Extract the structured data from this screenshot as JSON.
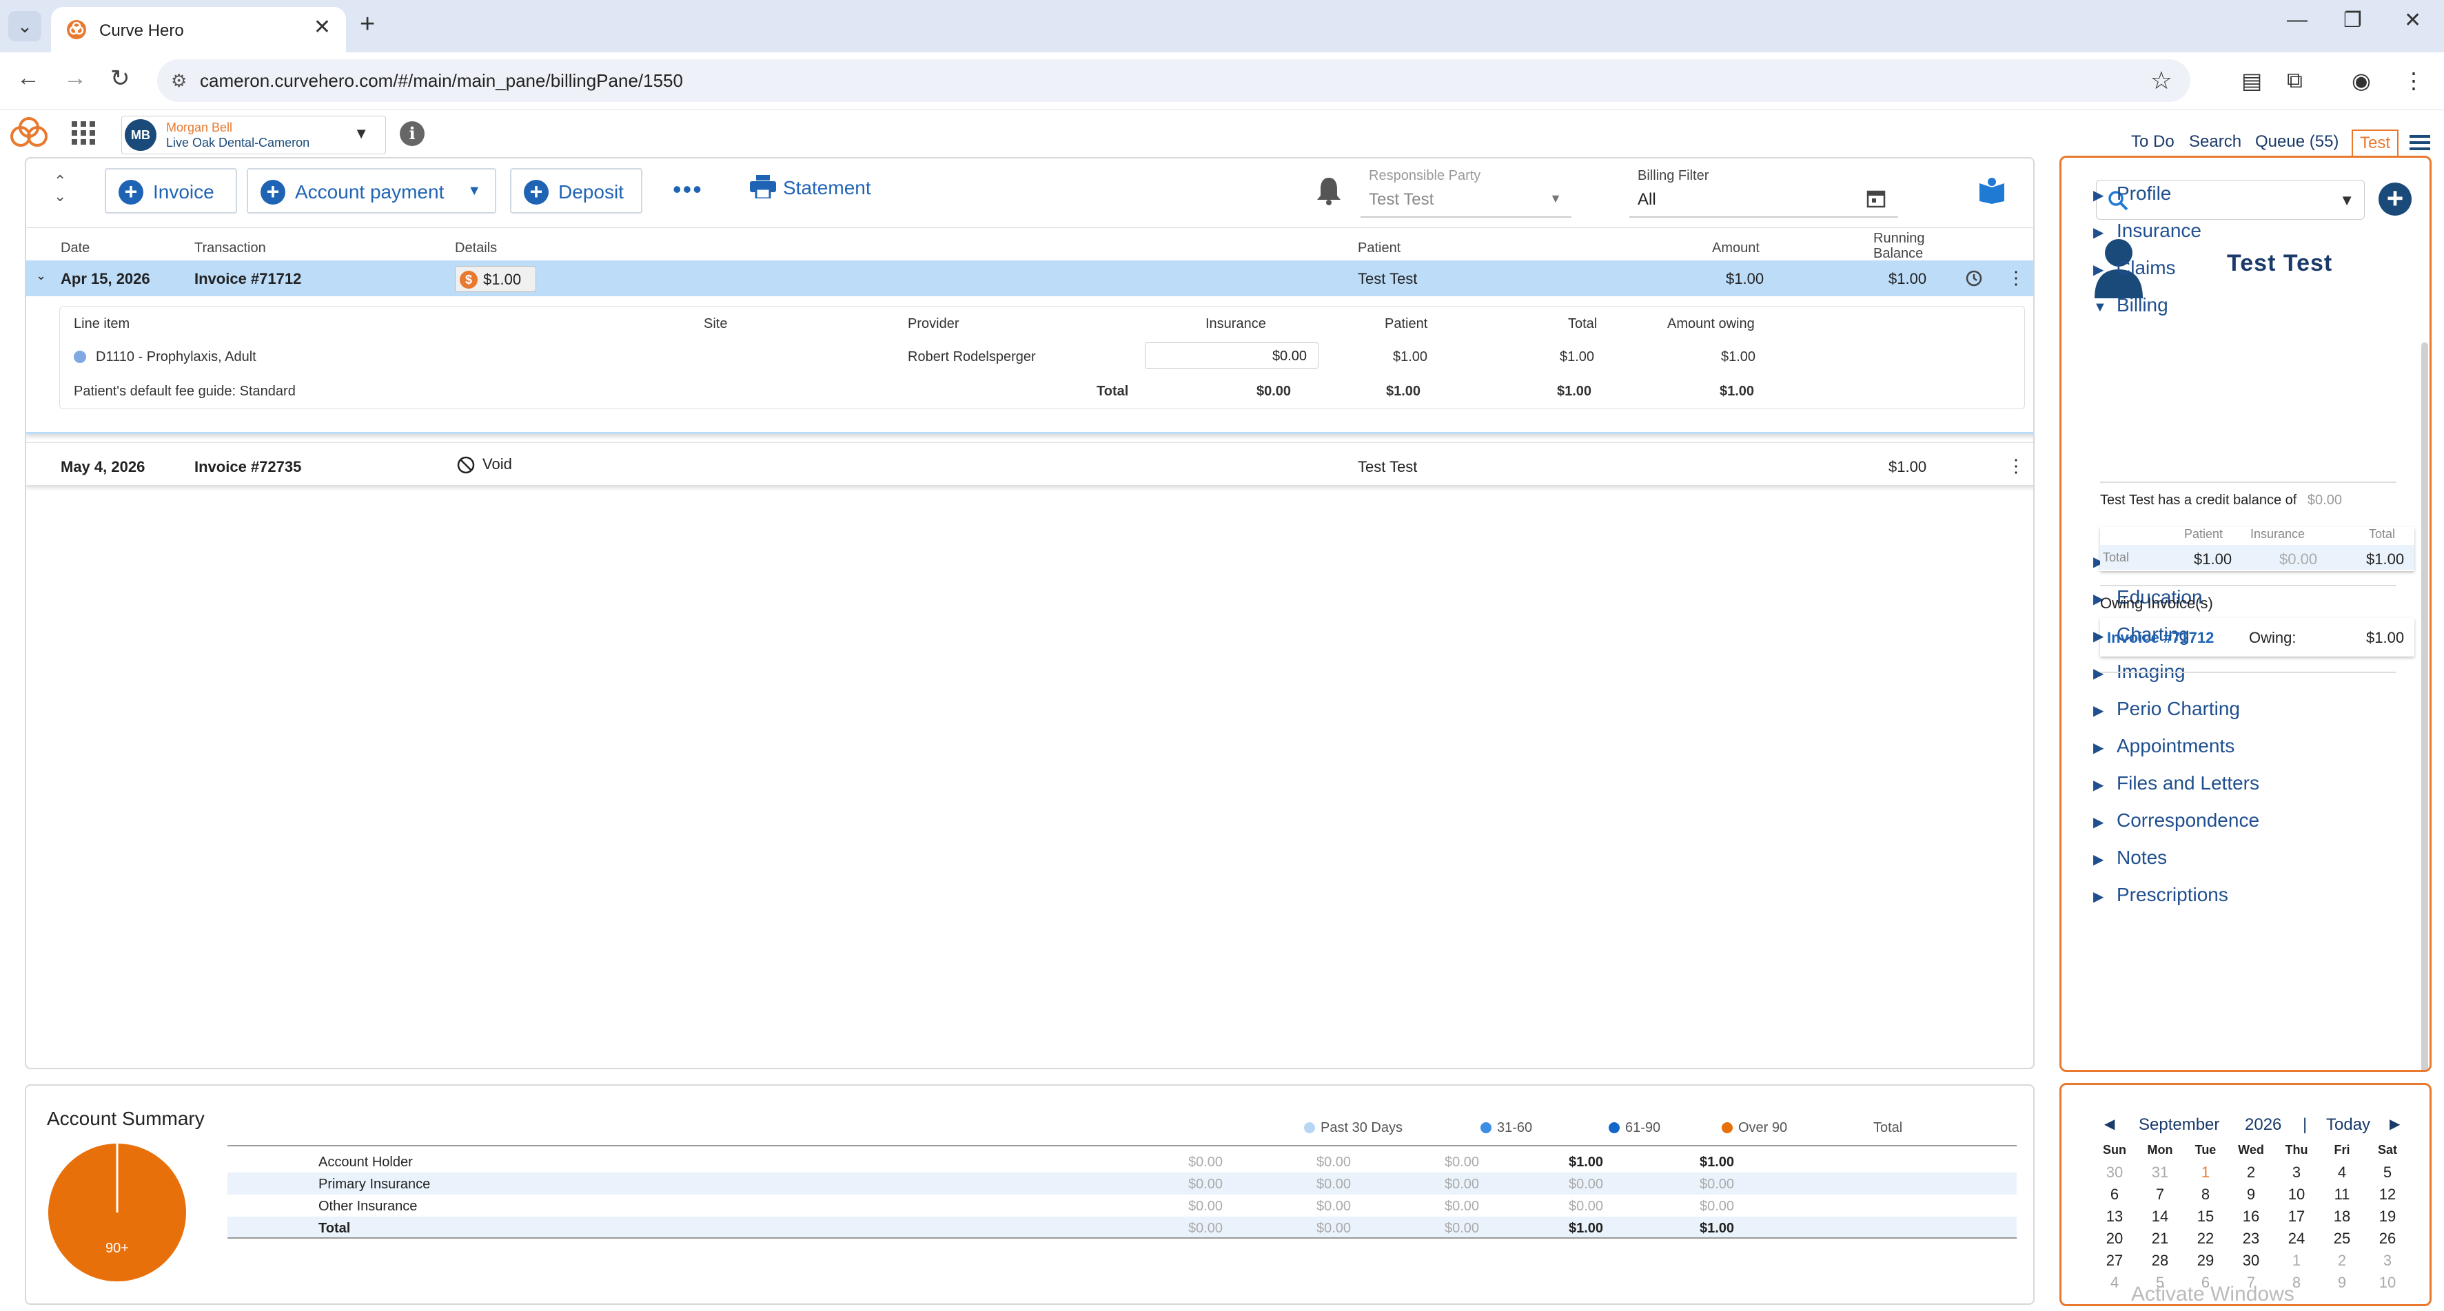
{
  "browser": {
    "tab_title": "Curve Hero",
    "url": "cameron.curvehero.com/#/main/main_pane/billingPane/1550"
  },
  "header": {
    "user_initials": "MB",
    "user_name": "Morgan Bell",
    "clinic": "Live Oak Dental-Cameron",
    "links": {
      "todo": "To Do",
      "search": "Search",
      "queue": "Queue (55)",
      "test": "Test"
    }
  },
  "toolbar": {
    "invoice": "Invoice",
    "account_payment": "Account payment",
    "deposit": "Deposit",
    "more": "•••",
    "statement": "Statement",
    "responsible_party_label": "Responsible Party",
    "responsible_party_value": "Test Test",
    "billing_filter_label": "Billing Filter",
    "billing_filter_value": "All"
  },
  "table": {
    "headers": {
      "date": "Date",
      "transaction": "Transaction",
      "details": "Details",
      "patient": "Patient",
      "amount": "Amount",
      "running_balance_1": "Running",
      "running_balance_2": "Balance"
    },
    "rows": [
      {
        "date": "Apr 15, 2026",
        "transaction": "Invoice #71712",
        "details": "$1.00",
        "patient": "Test Test",
        "amount": "$1.00",
        "balance": "$1.00"
      },
      {
        "date": "May 4, 2026",
        "transaction": "Invoice #72735",
        "details": "Void",
        "patient": "Test Test",
        "amount": "",
        "balance": "$1.00"
      }
    ],
    "detail": {
      "headers": {
        "line_item": "Line item",
        "site": "Site",
        "provider": "Provider",
        "insurance": "Insurance",
        "patient": "Patient",
        "total": "Total",
        "amount_owing": "Amount owing"
      },
      "item": {
        "code": "D1110 - Prophylaxis, Adult",
        "provider": "Robert Rodelsperger",
        "insurance": "$0.00",
        "patient": "$1.00",
        "total": "$1.00",
        "owing": "$1.00"
      },
      "footer": {
        "fee_guide": "Patient's default fee guide: Standard",
        "label": "Total",
        "insurance": "$0.00",
        "patient": "$1.00",
        "total": "$1.00",
        "owing": "$1.00"
      }
    }
  },
  "side": {
    "patient_name": "Test Test",
    "menu": [
      "Profile",
      "Insurance",
      "Claims",
      "Billing",
      "Recare",
      "Education",
      "Charting",
      "Imaging",
      "Perio Charting",
      "Appointments",
      "Files and Letters",
      "Correspondence",
      "Notes",
      "Prescriptions"
    ],
    "credit_text": "Test Test has a credit balance of",
    "credit_value": "$0.00",
    "summary": {
      "h_patient": "Patient",
      "h_insurance": "Insurance",
      "h_total": "Total",
      "label": "Total",
      "patient": "$1.00",
      "insurance": "$0.00",
      "total": "$1.00"
    },
    "owing_title": "Owing Invoice(s)",
    "owing_invoice": "Invoice #71712",
    "owing_label": "Owing:",
    "owing_value": "$1.00"
  },
  "account_summary": {
    "title": "Account Summary",
    "pie_label": "90+",
    "legend": [
      "Past 30 Days",
      "31-60",
      "61-90",
      "Over 90",
      "Total"
    ],
    "legend_colors": [
      "#b7d6f4",
      "#3b8ee3",
      "#1466c9",
      "#e8700a"
    ],
    "rows": [
      {
        "label": "Account Holder",
        "values": [
          "$0.00",
          "$0.00",
          "$0.00",
          "$1.00",
          "$1.00"
        ]
      },
      {
        "label": "Primary Insurance",
        "values": [
          "$0.00",
          "$0.00",
          "$0.00",
          "$0.00",
          "$0.00"
        ]
      },
      {
        "label": "Other Insurance",
        "values": [
          "$0.00",
          "$0.00",
          "$0.00",
          "$0.00",
          "$0.00"
        ]
      },
      {
        "label": "Total",
        "values": [
          "$0.00",
          "$0.00",
          "$0.00",
          "$1.00",
          "$1.00"
        ]
      }
    ]
  },
  "calendar": {
    "month": "September",
    "year": "2026",
    "today": "Today",
    "dow": [
      "Sun",
      "Mon",
      "Tue",
      "Wed",
      "Thu",
      "Fri",
      "Sat"
    ],
    "weeks": [
      [
        "30",
        "31",
        "1",
        "2",
        "3",
        "4",
        "5"
      ],
      [
        "6",
        "7",
        "8",
        "9",
        "10",
        "11",
        "12"
      ],
      [
        "13",
        "14",
        "15",
        "16",
        "17",
        "18",
        "19"
      ],
      [
        "20",
        "21",
        "22",
        "23",
        "24",
        "25",
        "26"
      ],
      [
        "27",
        "28",
        "29",
        "30",
        "1",
        "2",
        "3"
      ],
      [
        "4",
        "5",
        "6",
        "7",
        "8",
        "9",
        "10"
      ]
    ],
    "watermark": "Activate Windows"
  }
}
